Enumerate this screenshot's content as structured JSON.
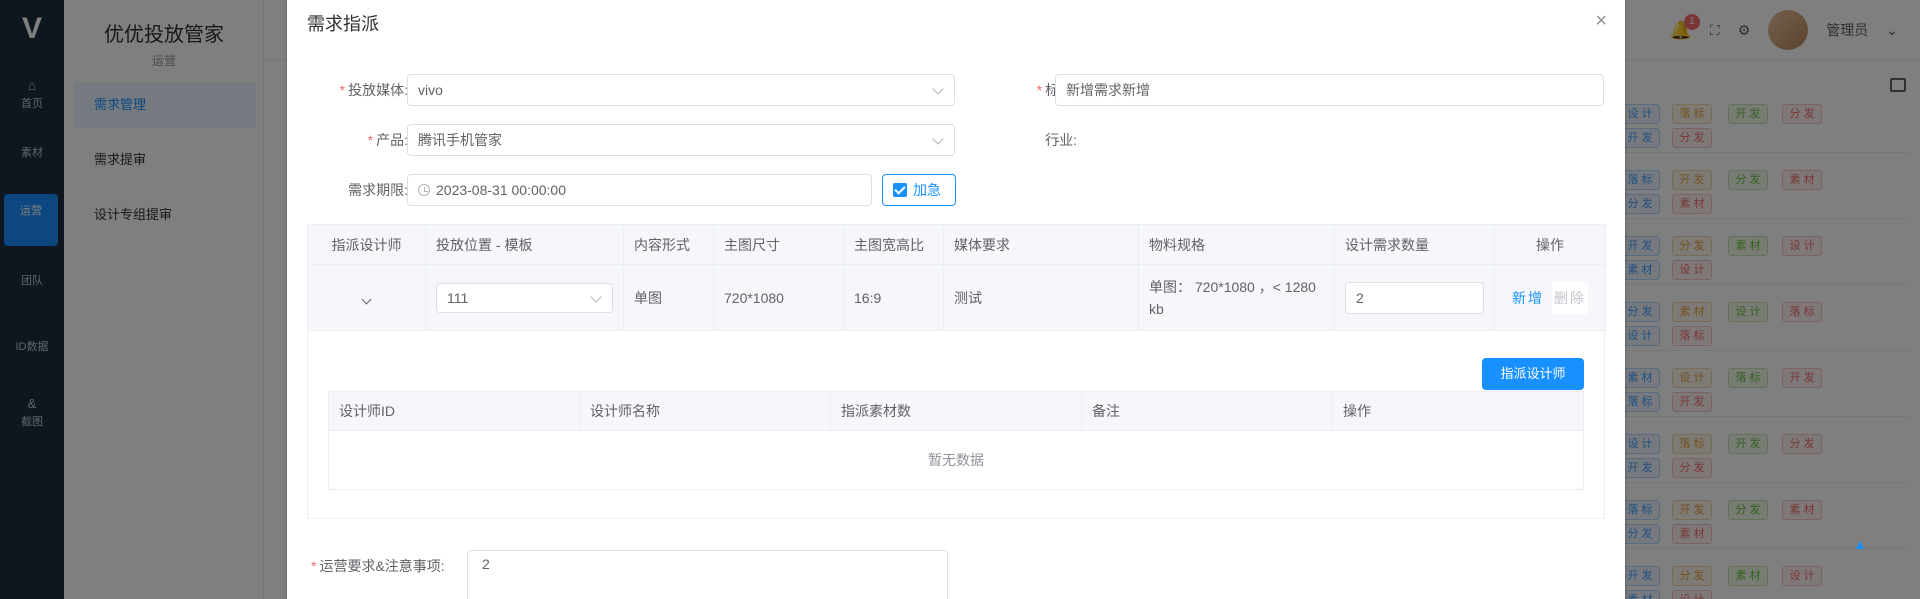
{
  "app": {
    "logo": "V",
    "side_title": "优优投放管家",
    "side_sub": "运营",
    "nav": [
      {
        "icon": "⌂",
        "label": "首页"
      },
      {
        "icon": "",
        "label": "素材"
      },
      {
        "icon": "",
        "label": "运营"
      },
      {
        "icon": "",
        "label": "团队"
      },
      {
        "icon": "",
        "label": "ID数据"
      },
      {
        "icon": "&",
        "label": "截图"
      }
    ],
    "side_items": [
      "需求管理",
      "需求提审",
      "设计专组提审"
    ],
    "top": {
      "badge_count": "1",
      "user_name": "管理员"
    },
    "bg_tags": [
      "设 计",
      "落 标",
      "开 发",
      "分 发",
      "素 材"
    ]
  },
  "dialog": {
    "title": "需求指派",
    "close_icon": "×",
    "form": {
      "media_label": "投放媒体:",
      "media_value": "vivo",
      "title_label": "标题:",
      "title_value": "新增需求新增",
      "product_label": "产品:",
      "product_value": "腾讯手机管家",
      "industry_label": "行业:",
      "industry_value": "-",
      "deadline_label": "需求期限:",
      "deadline_value": "2023-08-31 00:00:00",
      "urgent_label": "加急"
    },
    "table": {
      "headers": [
        "指派设计师",
        "投放位置 - 模板",
        "内容形式",
        "主图尺寸",
        "主图宽高比",
        "媒体要求",
        "物料规格",
        "设计需求数量",
        "操作"
      ],
      "row": {
        "position": "111",
        "content_form": "单图",
        "main_size": "720*1080",
        "ratio": "16:9",
        "media_req": "测试",
        "spec": "单图： 720*1080 ，< 1280 kb",
        "quantity": "2",
        "op_add": "新增",
        "op_delete": "删除"
      }
    },
    "assign_button": "指派设计师",
    "sub_table": {
      "headers": [
        "设计师ID",
        "设计师名称",
        "指派素材数",
        "备注",
        "操作"
      ],
      "empty": "暂无数据"
    },
    "notes_label": "运营要求&注意事项:",
    "notes_value": "2"
  },
  "colors": {
    "primary": "#1890ff",
    "required": "#f56c6c"
  }
}
